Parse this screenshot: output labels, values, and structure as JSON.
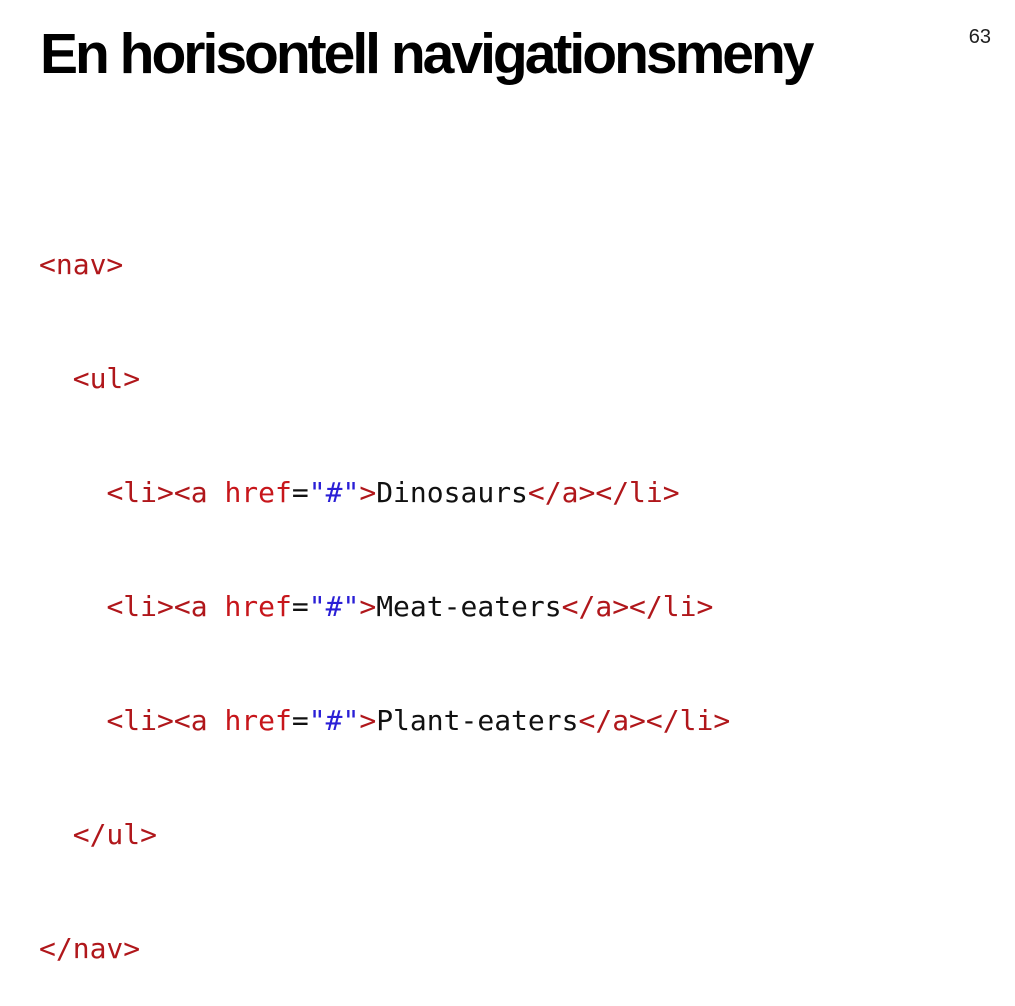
{
  "slide": {
    "title": "En horisontell navigationsmeny",
    "number": "63"
  },
  "colors": {
    "tag": "#b0171b",
    "attribute": "#c7161b",
    "string": "#2a1fd6",
    "text": "#111111"
  },
  "code": {
    "lines": [
      {
        "indent": 0,
        "tokens": [
          {
            "t": "<nav>",
            "k": "tag"
          }
        ]
      },
      {
        "indent": 1,
        "tokens": [
          {
            "t": "<ul>",
            "k": "tag"
          }
        ]
      },
      {
        "indent": 2,
        "tokens": [
          {
            "t": "<li><a ",
            "k": "tag"
          },
          {
            "t": "href",
            "k": "attr"
          },
          {
            "t": "=",
            "k": "eq"
          },
          {
            "t": "\"#\"",
            "k": "str"
          },
          {
            "t": ">",
            "k": "tag"
          },
          {
            "t": "Dinosaurs",
            "k": "text"
          },
          {
            "t": "</a></li>",
            "k": "tag"
          }
        ]
      },
      {
        "indent": 2,
        "tokens": [
          {
            "t": "<li><a ",
            "k": "tag"
          },
          {
            "t": "href",
            "k": "attr"
          },
          {
            "t": "=",
            "k": "eq"
          },
          {
            "t": "\"#\"",
            "k": "str"
          },
          {
            "t": ">",
            "k": "tag"
          },
          {
            "t": "Meat-eaters",
            "k": "text"
          },
          {
            "t": "</a></li>",
            "k": "tag"
          }
        ]
      },
      {
        "indent": 2,
        "tokens": [
          {
            "t": "<li><a ",
            "k": "tag"
          },
          {
            "t": "href",
            "k": "attr"
          },
          {
            "t": "=",
            "k": "eq"
          },
          {
            "t": "\"#\"",
            "k": "str"
          },
          {
            "t": ">",
            "k": "tag"
          },
          {
            "t": "Plant-eaters",
            "k": "text"
          },
          {
            "t": "</a></li>",
            "k": "tag"
          }
        ]
      },
      {
        "indent": 1,
        "tokens": [
          {
            "t": "</ul>",
            "k": "tag"
          }
        ]
      },
      {
        "indent": 0,
        "tokens": [
          {
            "t": "</nav>",
            "k": "tag"
          }
        ]
      }
    ]
  }
}
